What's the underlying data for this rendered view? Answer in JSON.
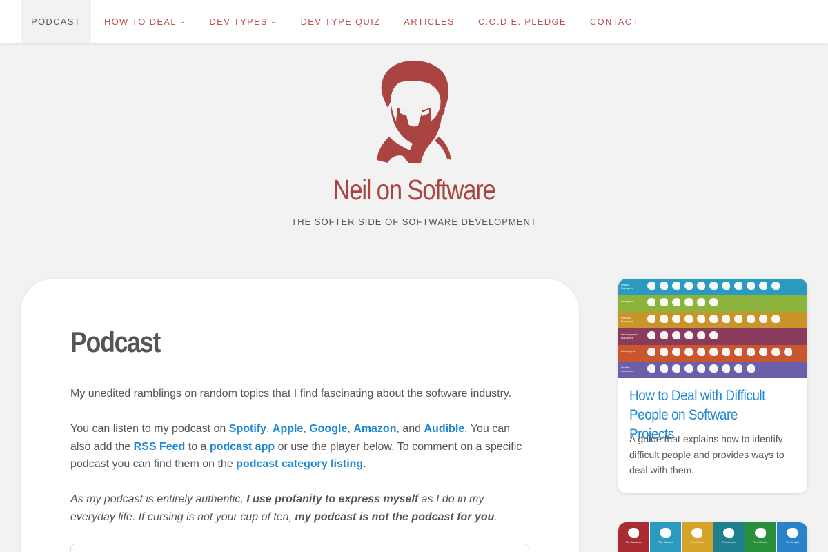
{
  "nav": {
    "items": [
      {
        "label": "PODCAST",
        "active": true,
        "dropdown": false
      },
      {
        "label": "HOW TO DEAL",
        "active": false,
        "dropdown": true
      },
      {
        "label": "DEV TYPES",
        "active": false,
        "dropdown": true
      },
      {
        "label": "DEV TYPE QUIZ",
        "active": false,
        "dropdown": false
      },
      {
        "label": "ARTICLES",
        "active": false,
        "dropdown": false
      },
      {
        "label": "C.O.D.E. PLEDGE",
        "active": false,
        "dropdown": false
      },
      {
        "label": "CONTACT",
        "active": false,
        "dropdown": false
      }
    ],
    "chevron": "⌄"
  },
  "header": {
    "logo_icon": "thinking-man-silhouette-icon",
    "site_title": "Neil on Software",
    "tagline": "THE SOFTER SIDE OF SOFTWARE DEVELOPMENT"
  },
  "main": {
    "title": "Podcast",
    "p1": "My unedited ramblings on random topics that I find fascinating about the software industry.",
    "p2": {
      "t1": "You can listen to my podcast on ",
      "spotify": "Spotify",
      "c1": ", ",
      "apple": "Apple",
      "c2": ", ",
      "google": "Google",
      "c3": ", ",
      "amazon": "Amazon",
      "c4": ", and ",
      "audible": "Audible",
      "t2": ". You can also add the ",
      "rss": "RSS Feed",
      "t3": " to a ",
      "podcast_app": "podcast app",
      "t4": " or use the player below. To comment on a specific podcast you can find them on the ",
      "category": "podcast category listing",
      "t5": "."
    },
    "p3": {
      "t1": "As my podcast is entirely authentic, ",
      "b1": "I use profanity to express myself",
      "t2": " as I do in my everyday life. If cursing is not your cup of tea, ",
      "b2": "my podcast is not the podcast for you",
      "t3": "."
    }
  },
  "sidebar": {
    "card1": {
      "title": "How to Deal with Difficult People on Software Projects",
      "description": "A guide that explains how to identify difficult people and provides ways to deal with them.",
      "bands": [
        {
          "label": "Project Managers",
          "color": "#2a9bbf"
        },
        {
          "label": "Designers",
          "color": "#8cb33b"
        },
        {
          "label": "Product Managers",
          "color": "#c9952a"
        },
        {
          "label": "Development Managers",
          "color": "#8a3a5a"
        },
        {
          "label": "Developers",
          "color": "#c9562e"
        },
        {
          "label": "Quality Assurance",
          "color": "#6a5fa8"
        }
      ]
    },
    "card2": {
      "tiles": [
        {
          "label": "The Assassin",
          "color": "#a92b33"
        },
        {
          "label": "The Wizard",
          "color": "#2a9bbf"
        },
        {
          "label": "The Scout",
          "color": "#d4a42a"
        },
        {
          "label": "The Hunter",
          "color": "#1f7f8f"
        },
        {
          "label": "The Mentor",
          "color": "#2a8f3a"
        },
        {
          "label": "The Knight",
          "color": "#2a82c9"
        }
      ]
    }
  },
  "colors": {
    "accent": "#c0504d",
    "title_red": "#a94440",
    "link_blue": "#1e87d6"
  }
}
